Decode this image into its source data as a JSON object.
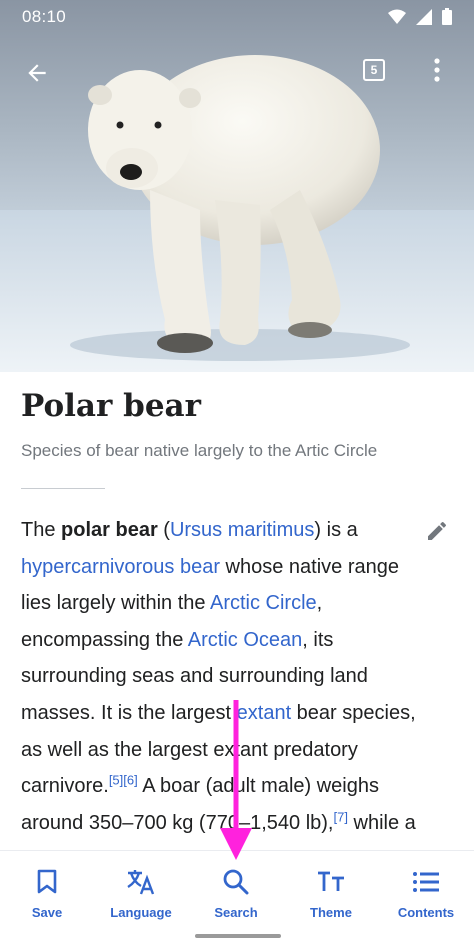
{
  "status_bar": {
    "time": "08:10"
  },
  "toolbar": {
    "tab_count": "5"
  },
  "article": {
    "title": "Polar bear",
    "description": "Species of bear native largely to the Artic Circle",
    "lines": [
      [
        {
          "t": "The "
        },
        {
          "t": "polar bear",
          "b": true
        },
        {
          "t": " ("
        },
        {
          "t": "Ursus maritimus",
          "link": true
        },
        {
          "t": ") is a"
        }
      ],
      [
        {
          "t": "hypercarnivorous bear",
          "link": true
        },
        {
          "t": " whose native range"
        }
      ],
      [
        {
          "t": "lies largely within the "
        },
        {
          "t": "Arctic Circle",
          "link": true
        },
        {
          "t": ","
        }
      ],
      [
        {
          "t": "encompassing the "
        },
        {
          "t": "Arctic Ocean",
          "link": true
        },
        {
          "t": ", its"
        }
      ],
      [
        {
          "t": "surrounding seas and surrounding land"
        }
      ],
      [
        {
          "t": "masses. It is the largest "
        },
        {
          "t": "extant",
          "link": true
        },
        {
          "t": " bear species,"
        }
      ],
      [
        {
          "t": "as well as the largest extant predatory"
        }
      ],
      [
        {
          "t": "carnivore."
        },
        {
          "t": "[5]",
          "ref": true
        },
        {
          "t": "[6]",
          "ref": true
        },
        {
          "t": " A boar (adult male) weighs"
        }
      ],
      [
        {
          "t": "around 350–700 kg (770–1,540 lb),"
        },
        {
          "t": "[7]",
          "ref": true
        },
        {
          "t": " while a"
        }
      ]
    ]
  },
  "bottom_nav": {
    "items": [
      {
        "label": "Save",
        "icon": "bookmark-icon"
      },
      {
        "label": "Language",
        "icon": "translate-icon"
      },
      {
        "label": "Search",
        "icon": "search-icon"
      },
      {
        "label": "Theme",
        "icon": "text-size-icon"
      },
      {
        "label": "Contents",
        "icon": "list-icon"
      }
    ]
  },
  "colors": {
    "link": "#3366cc",
    "text": "#202122",
    "muted": "#72777d",
    "annotation": "#ff22dd"
  }
}
